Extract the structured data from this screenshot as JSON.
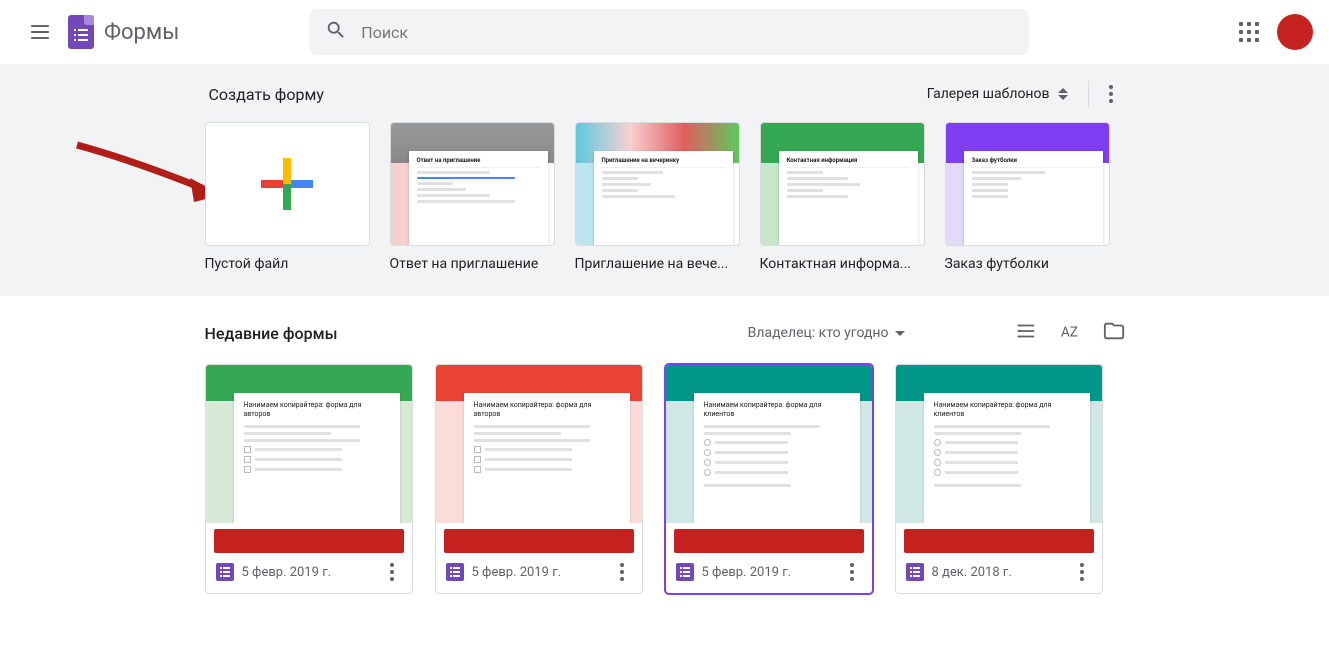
{
  "header": {
    "app_name": "Формы",
    "search_placeholder": "Поиск"
  },
  "templates": {
    "title": "Создать форму",
    "gallery_label": "Галерея шаблонов",
    "items": [
      {
        "label": "Пустой файл",
        "thumb_title": ""
      },
      {
        "label": "Ответ на приглашение",
        "thumb_title": "Ответ на приглашение"
      },
      {
        "label": "Приглашение на вече...",
        "thumb_title": "Приглашение на вечеринку"
      },
      {
        "label": "Контактная информа...",
        "thumb_title": "Контактная информация"
      },
      {
        "label": "Заказ футболки",
        "thumb_title": "Заказ футболки"
      }
    ]
  },
  "recent": {
    "title": "Недавние формы",
    "owner_filter": "Владелец: кто угодно",
    "items": [
      {
        "date": "5 февр. 2019 г.",
        "thumb_title": "Нанимаем копирайтера: форма для авторов",
        "color": "green",
        "selected": false
      },
      {
        "date": "5 февр. 2019 г.",
        "thumb_title": "Нанимаем копирайтера: форма для авторов",
        "color": "red",
        "selected": false
      },
      {
        "date": "5 февр. 2019 г.",
        "thumb_title": "Нанимаем копирайтера: форма для клиентов",
        "color": "teal",
        "selected": true
      },
      {
        "date": "8 дек. 2018 г.",
        "thumb_title": "Нанимаем копирайтера: форма для клиентов",
        "color": "teal",
        "selected": false
      }
    ]
  },
  "colors": {
    "brand_purple": "#7248b9",
    "annotation_red": "#b01e17"
  }
}
